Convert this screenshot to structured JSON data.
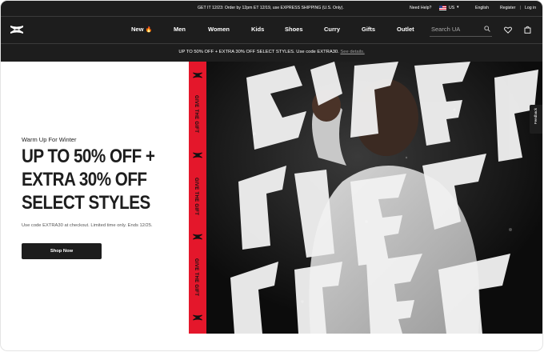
{
  "utility_bar": {
    "promo": "GET IT 12/23: Order by 12pm ET 12/19, use EXPRESS SHIPPING (U.S. Only).",
    "help": "Need Help?",
    "country": "US",
    "language": "English",
    "register": "Register",
    "separator": "|",
    "login": "Log in"
  },
  "nav": {
    "items": [
      {
        "label": "New"
      },
      {
        "label": "Men"
      },
      {
        "label": "Women"
      },
      {
        "label": "Kids"
      },
      {
        "label": "Shoes"
      },
      {
        "label": "Curry"
      },
      {
        "label": "Gifts"
      },
      {
        "label": "Outlet"
      }
    ],
    "new_badge": "🔥",
    "search_placeholder": "Search UA"
  },
  "promo_bar": {
    "text": "UP TO 50% OFF + EXTRA 30% OFF SELECT STYLES. Use code EXTRA30.",
    "link": "See details."
  },
  "hero": {
    "eyebrow": "Warm Up For Winter",
    "headline": [
      "UP TO 50% OFF +",
      "EXTRA 30% OFF",
      "SELECT STYLES"
    ],
    "subcopy": "Use code EXTRA30 at checkout. Limited time only. Ends 12/25.",
    "cta": "Shop Now",
    "strip_text": [
      "GIVE THE GIFT",
      "GIVE THE GIFT",
      "GIVE THE GIFT"
    ],
    "image_lettering": "GIVE THE GIFT",
    "strip_color": "#e4172b"
  },
  "feedback_tab": "Feedback",
  "colors": {
    "header_bg": "#1d1d1d",
    "accent_red": "#e4172b"
  },
  "icons": [
    "ua-logo-icon",
    "flag-us-icon",
    "chevron-down-icon",
    "fire-icon",
    "search-icon",
    "heart-icon",
    "bag-icon"
  ]
}
